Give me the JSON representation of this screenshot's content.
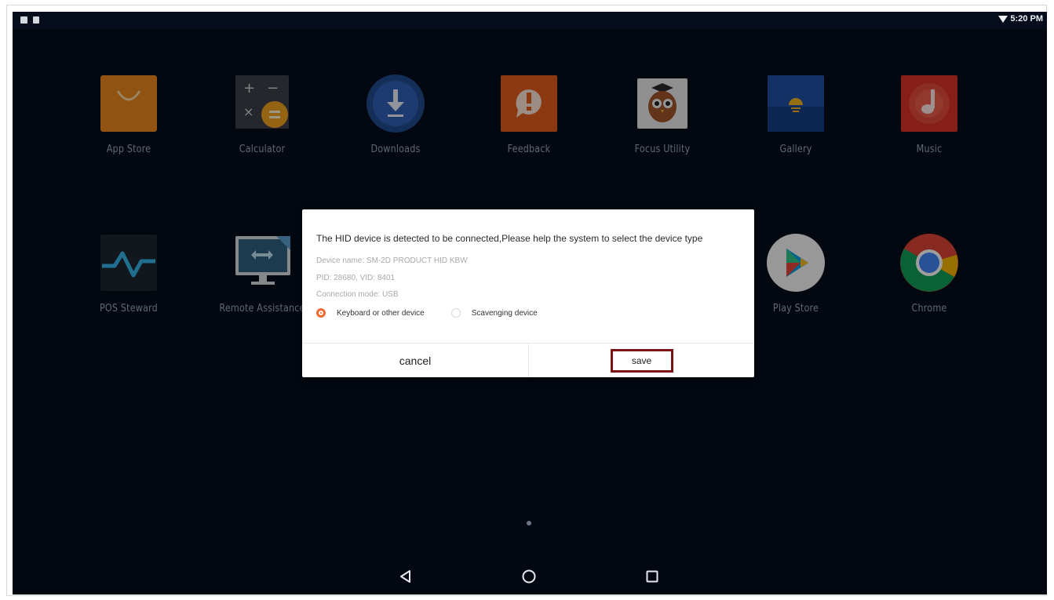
{
  "status_bar": {
    "time": "5:20 PM",
    "left_icons": [
      "image-notification-icon",
      "notification-icon"
    ],
    "right_icons": [
      "wifi-icon"
    ]
  },
  "apps": [
    {
      "label": "App Store",
      "icon": "shopping-bag-icon",
      "color": "#e8861e"
    },
    {
      "label": "Calculator",
      "icon": "calculator-icon",
      "color": "#3c4048"
    },
    {
      "label": "Downloads",
      "icon": "download-icon",
      "color": "#2f5fb5"
    },
    {
      "label": "Feedback",
      "icon": "feedback-icon",
      "color": "#e35d1d"
    },
    {
      "label": "Focus Utility",
      "icon": "owl-icon",
      "color": "#e9e9e9"
    },
    {
      "label": "Gallery",
      "icon": "sunset-icon",
      "color": "#1f4fa3"
    },
    {
      "label": "Music",
      "icon": "music-note-icon",
      "color": "#d8332a"
    },
    {
      "label": "POS Steward",
      "icon": "pulse-icon",
      "color": "#1e2430"
    },
    {
      "label": "Remote Assistance",
      "icon": "remote-monitor-icon",
      "color": "#3a6a8c"
    },
    {
      "label": "Play Store",
      "icon": "play-store-icon",
      "color": "#ffffff"
    },
    {
      "label": "Chrome",
      "icon": "chrome-icon",
      "color": "#db4437"
    }
  ],
  "dialog": {
    "title": "The HID device is detected to be connected,Please help the system to select the device type",
    "device_name": "Device name: SM-2D PRODUCT HID KBW",
    "pid_vid": "PID: 28680, VID: 8401",
    "connection_mode": "Connection mode: USB",
    "options": [
      {
        "label": "Keyboard or other device",
        "selected": true
      },
      {
        "label": "Scavenging device",
        "selected": false
      }
    ],
    "cancel_label": "cancel",
    "save_label": "save",
    "accent_color": "#ef6c31",
    "highlight_color": "#7a1414"
  },
  "navigation": {
    "icons": [
      "back-icon",
      "home-icon",
      "recents-icon"
    ]
  }
}
